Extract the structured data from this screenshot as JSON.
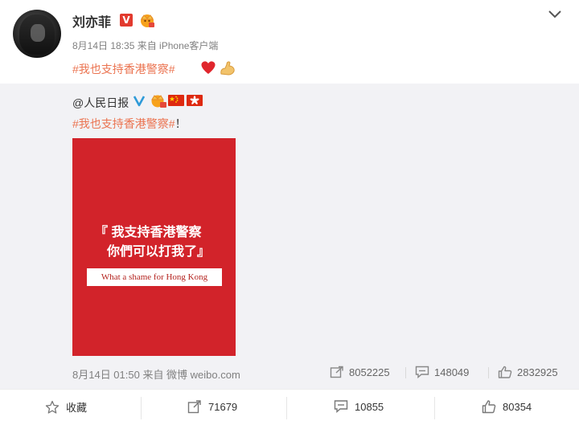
{
  "post": {
    "author": "刘亦菲",
    "verified_badge": "V",
    "meta": "8月14日 18:35 来自 iPhone客户端",
    "text": "#我也支持香港警察#",
    "emojis": [
      "heart-emoji",
      "muscle-emoji"
    ]
  },
  "repost": {
    "author": "@人民日报",
    "text_tag": "#我也支持香港警察#",
    "text_suffix": "！",
    "image": {
      "line1": "『 我支持香港警察",
      "line2": "你們可以打我了』",
      "banner": "What a shame for Hong Kong"
    },
    "meta": "8月14日 01:50 来自 微博 weibo.com",
    "stats": {
      "reposts": "8052225",
      "comments": "148049",
      "likes": "2832925"
    }
  },
  "footer": {
    "favorite_label": "收藏",
    "repost_count": "71679",
    "comment_count": "10855",
    "like_count": "80354"
  },
  "colors": {
    "topic": "#eb7350",
    "card_red": "#d2232a",
    "repost_bg": "#f2f2f5"
  }
}
